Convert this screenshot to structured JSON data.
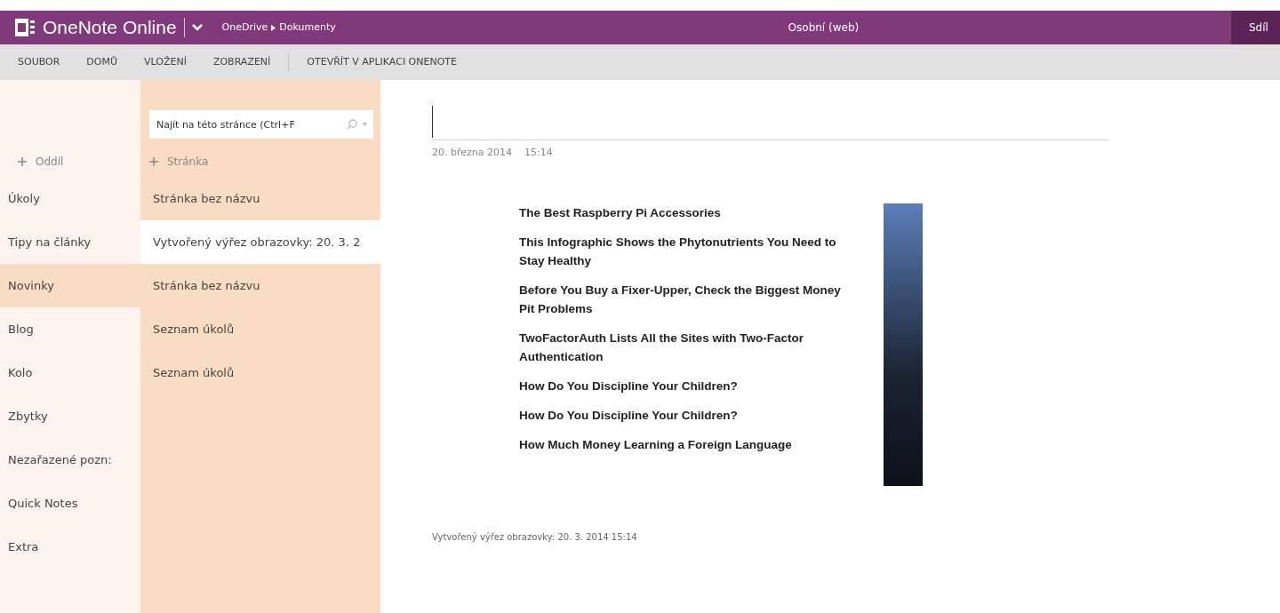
{
  "app_bar": {
    "app_name": "OneNote Online",
    "breadcrumb": [
      "OneDrive",
      "Dokumenty"
    ],
    "notebook_title": "Osobní (web)",
    "share_button": "Sdíl"
  },
  "ribbon_tabs": [
    {
      "label": "SOUBOR"
    },
    {
      "label": "DOMŮ"
    },
    {
      "label": "VLOŽENÍ"
    },
    {
      "label": "ZOBRAZENÍ"
    },
    {
      "label": "OTEVŘÍT V APLIKACI ONENOTE"
    }
  ],
  "sections": {
    "add_label": "Oddíl",
    "items": [
      {
        "label": "Úkoly",
        "selected": false
      },
      {
        "label": "Tipy na články",
        "selected": false
      },
      {
        "label": "Novinky",
        "selected": true
      },
      {
        "label": "Blog",
        "selected": false
      },
      {
        "label": "Kolo",
        "selected": false
      },
      {
        "label": "Zbytky",
        "selected": false
      },
      {
        "label": "Nezařazené pozn:",
        "selected": false
      },
      {
        "label": "Quick Notes",
        "selected": false
      },
      {
        "label": "Extra",
        "selected": false
      }
    ]
  },
  "pages": {
    "search": {
      "placeholder": "Najít na této stránce (Ctrl+F"
    },
    "add_label": "Stránka",
    "items": [
      {
        "label": "Stránka bez názvu",
        "selected": false
      },
      {
        "label": "Vytvořený výřez obrazovky: 20. 3. 2",
        "selected": true
      },
      {
        "label": "Stránka bez názvu",
        "selected": false
      },
      {
        "label": "Seznam úkolů",
        "selected": false
      },
      {
        "label": "Seznam úkolů",
        "selected": false
      }
    ]
  },
  "note": {
    "date": "20. března 2014",
    "time": "15:14",
    "clip_lines": [
      "The Best Raspberry Pi Accessories",
      "This Infographic Shows the Phytonutrients You Need to Stay Healthy",
      "Before You Buy a Fixer-Upper, Check the Biggest Money Pit Problems",
      "TwoFactorAuth Lists All the Sites with Two-Factor Authentication",
      "How Do You Discipline Your Children?",
      "How Do You Discipline Your Children?",
      "How Much Money Learning a Foreign Language"
    ],
    "caption": "Vytvořený výřez obrazovky: 20. 3. 2014 15:14"
  }
}
